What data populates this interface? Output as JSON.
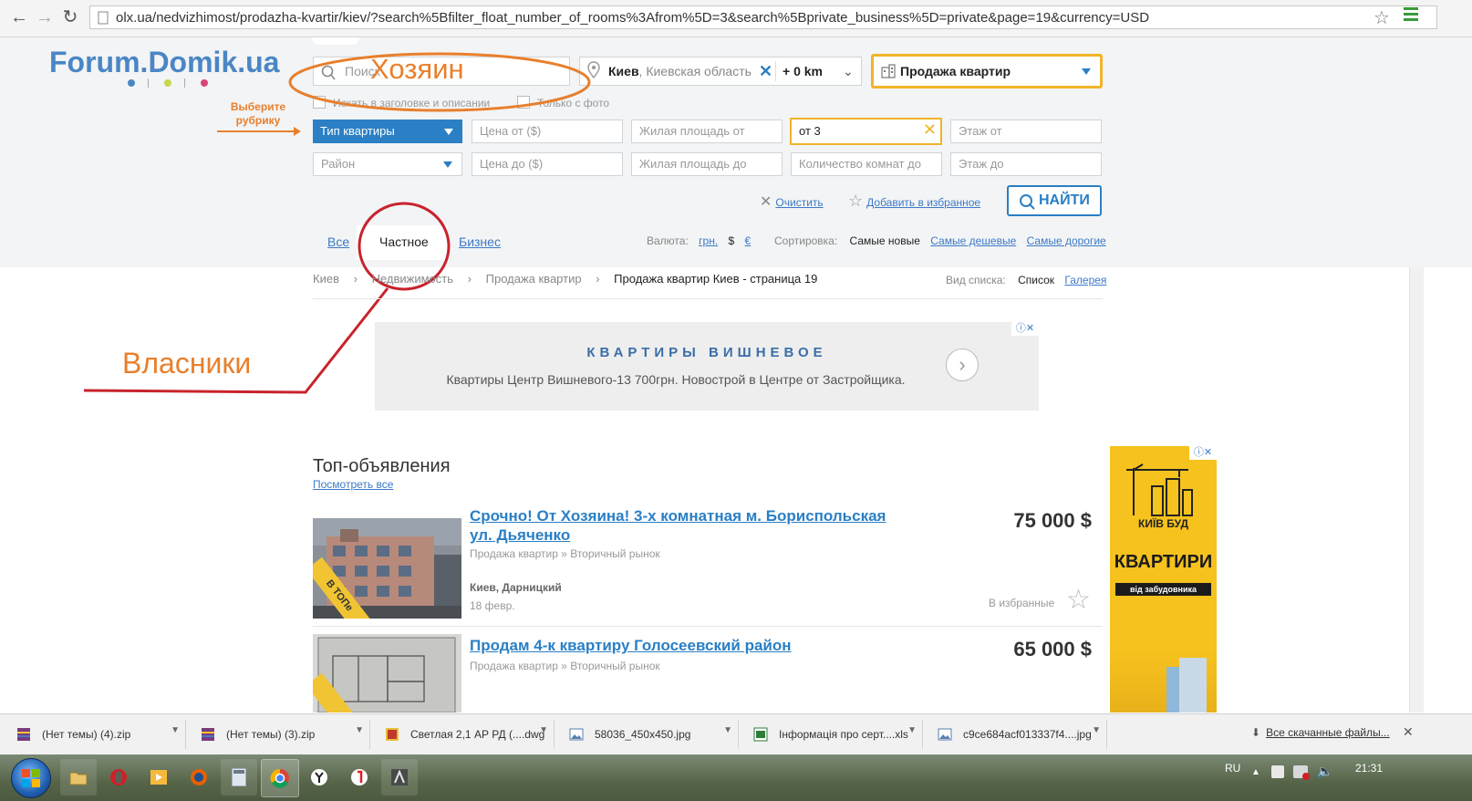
{
  "browser": {
    "url": "olx.ua/nedvizhimost/prodazha-kvartir/kiev/?search%5Bfilter_float_number_of_rooms%3Afrom%5D=3&search%5Bprivate_business%5D=private&page=19&currency=USD"
  },
  "header": {
    "logo": "Forum.Domik.ua",
    "search_placeholder": "Поиск",
    "annotation_owner": "Хозяин",
    "location_city": "Киев",
    "location_region": ", Киевская область",
    "radius": "+ 0 km",
    "category": "Продажа квартир",
    "checkbox_titles": "Искать в заголовке и описании",
    "checkbox_photo": "Только с фото",
    "choose_rubric_line1": "Выберите",
    "choose_rubric_line2": "рубрику"
  },
  "filters": {
    "type": "Тип квартиры",
    "district": "Район",
    "price_from": "Цена от ($)",
    "price_to": "Цена до ($)",
    "area_from": "Жилая площадь от",
    "area_to": "Жилая площадь до",
    "rooms_from_value": "от 3",
    "rooms_to": "Количество комнат до",
    "floor_from": "Этаж от",
    "floor_to": "Этаж до",
    "clear": "Очистить",
    "favorite": "Добавить в избранное",
    "find": "НАЙТИ"
  },
  "tabs": {
    "all": "Все",
    "private": "Частное",
    "business": "Бизнес"
  },
  "currency": {
    "label": "Валюта:",
    "uah": "грн.",
    "usd": "$",
    "eur": "€"
  },
  "sort": {
    "label": "Сортировка:",
    "newest": "Самые новые",
    "cheapest": "Самые дешевые",
    "expensive": "Самые дорогие"
  },
  "breadcrumb": {
    "kiev": "Киев",
    "realty": "Недвижимость",
    "sale": "Продажа квартир",
    "current": "Продажа квартир Киев - страница 19"
  },
  "view": {
    "label": "Вид списка:",
    "list": "Список",
    "gallery": "Галерея"
  },
  "ad_banner": {
    "title": "КВАРТИРЫ ВИШНЕВОЕ",
    "text": "Квартиры Центр Вишневого-13 700грн. Новострой в Центре от Застройщика."
  },
  "annotation_owners": "Власники",
  "top": {
    "title": "Топ-объявления",
    "see_all": "Посмотреть все"
  },
  "listings": [
    {
      "title": "Срочно! От Хозяина! 3-х комнатная м. Бориспольская ул. Дьяченко",
      "category": "Продажа квартир » Вторичный рынок",
      "location": "Киев, Дарницкий",
      "date": "18 февр.",
      "price": "75 000 $",
      "fav": "В избранные",
      "badge": "В ТОПе"
    },
    {
      "title": "Продам 4-к квартиру Голосеевский район",
      "category": "Продажа квартир » Вторичный рынок",
      "price": "65 000 $"
    }
  ],
  "side_ad": {
    "brand": "КИЇВ БУД",
    "title": "КВАРТИРИ",
    "subtitle": "від забудовника"
  },
  "downloads": {
    "items": [
      "(Нет темы) (4).zip",
      "(Нет темы) (3).zip",
      "Светлая 2,1 АР РД (....dwg",
      "58036_450x450.jpg",
      "Інформація про серт....xls",
      "c9ce684acf013337f4....jpg"
    ],
    "all": "Все скачанные файлы..."
  },
  "taskbar": {
    "lang": "RU",
    "time": "21:31"
  },
  "colors": {
    "blue": "#2a7fc5",
    "highlight": "#f0b429",
    "annotation_orange": "#e87f2c",
    "annotation_red": "#c8232c"
  }
}
